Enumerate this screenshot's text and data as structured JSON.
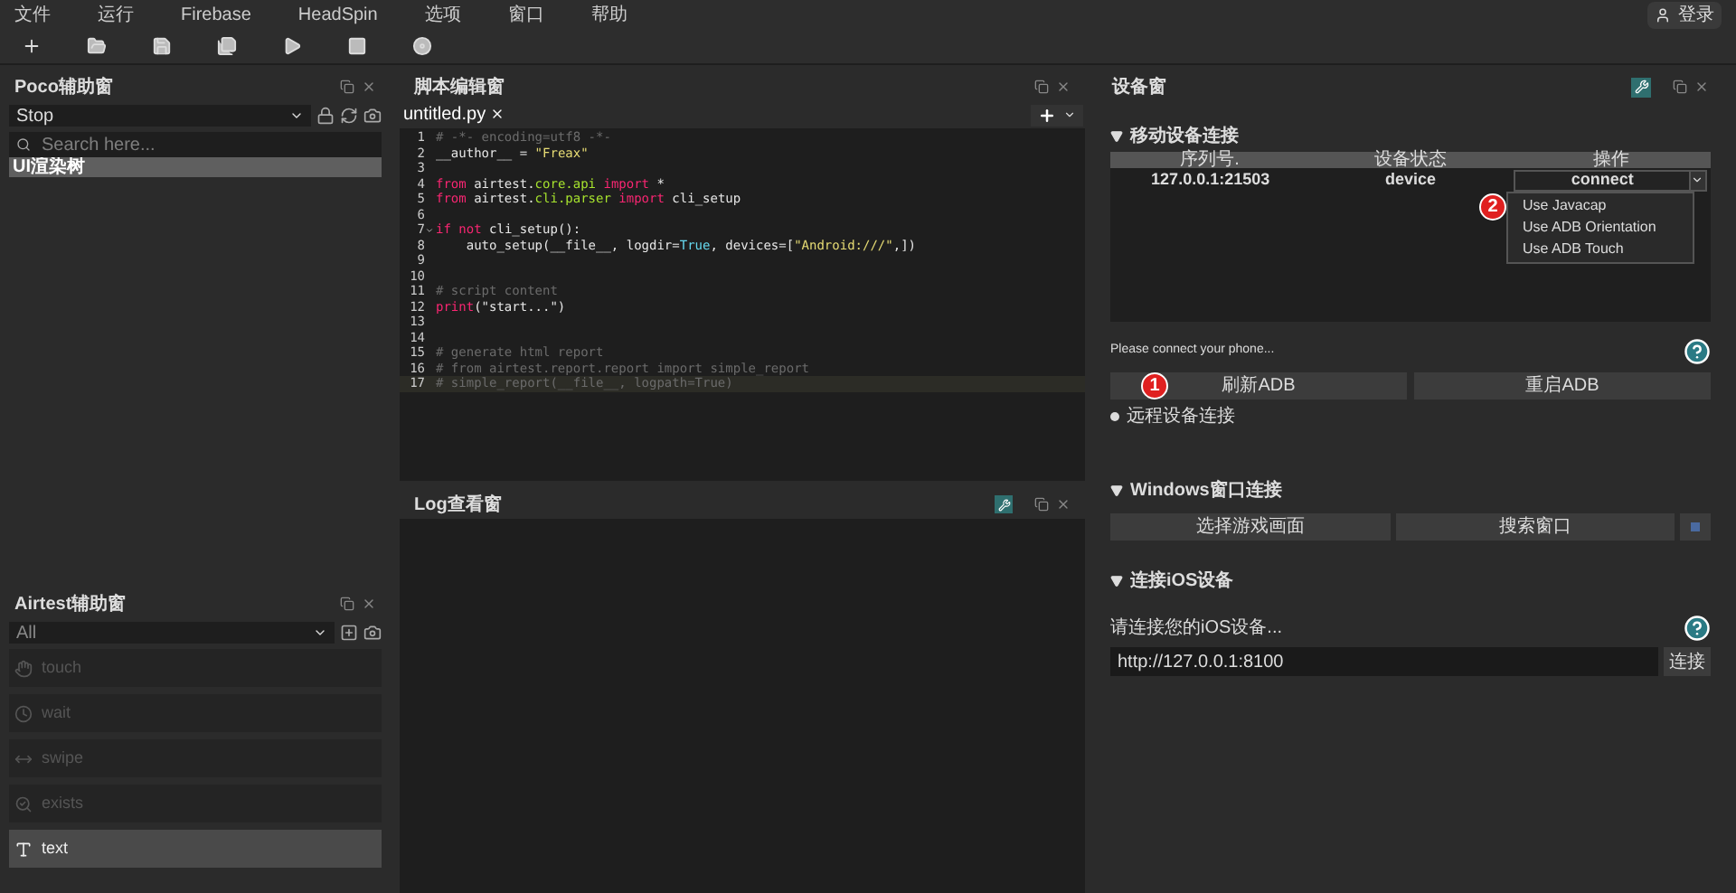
{
  "menu": [
    "文件",
    "运行",
    "Firebase",
    "HeadSpin",
    "选项",
    "窗口",
    "帮助"
  ],
  "user": "登录",
  "toolbar": [
    {
      "kind": "new"
    },
    {
      "kind": "open"
    },
    {
      "kind": "save"
    },
    {
      "kind": "saveas"
    },
    {
      "kind": "run"
    },
    {
      "kind": "stop"
    },
    {
      "kind": "record"
    }
  ],
  "poco": {
    "title": "Poco辅助窗",
    "mode": "Stop",
    "search": {
      "placeholder": "Search here..."
    },
    "tree": [
      {
        "label": "UI渲染树",
        "selected": true
      }
    ]
  },
  "airtest": {
    "title": "Airtest辅助窗",
    "filter": "All",
    "items": [
      {
        "label": "touch",
        "kind": "touch",
        "disabled": true
      },
      {
        "label": "wait",
        "kind": "wait",
        "disabled": true
      },
      {
        "label": "swipe",
        "kind": "swipe",
        "disabled": true
      },
      {
        "label": "exists",
        "kind": "exists",
        "disabled": true
      },
      {
        "label": "text",
        "kind": "text",
        "disabled": false
      }
    ]
  },
  "editor": {
    "title": "脚本编辑窗",
    "tabs": [
      {
        "label": "untitled.py",
        "selected": true
      }
    ],
    "lines": [
      {
        "n": "1",
        "fold": false,
        "current": false,
        "tokens": [
          {
            "kind": "comment",
            "text": "# -*- encoding=utf8 -*-"
          }
        ]
      },
      {
        "n": "2",
        "fold": false,
        "current": false,
        "tokens": [
          {
            "kind": "plain",
            "text": "__author__ = "
          },
          {
            "kind": "string",
            "text": "\"Freax\""
          }
        ]
      },
      {
        "n": "3",
        "fold": false,
        "current": false
      },
      {
        "n": "4",
        "fold": false,
        "current": false,
        "tokens": [
          {
            "kind": "keyword",
            "text": "from "
          },
          {
            "kind": "plain",
            "text": "airtest."
          },
          {
            "kind": "module",
            "text": "core.api"
          },
          {
            "kind": "keyword",
            "text": " import "
          },
          {
            "kind": "plain",
            "text": "*"
          }
        ]
      },
      {
        "n": "5",
        "fold": false,
        "current": false,
        "tokens": [
          {
            "kind": "keyword",
            "text": "from "
          },
          {
            "kind": "plain",
            "text": "airtest."
          },
          {
            "kind": "module",
            "text": "cli.parser"
          },
          {
            "kind": "keyword",
            "text": " import "
          },
          {
            "kind": "plain",
            "text": "cli_setup"
          }
        ]
      },
      {
        "n": "6",
        "fold": false,
        "current": false
      },
      {
        "n": "7",
        "fold": true,
        "current": false,
        "tokens": [
          {
            "kind": "keyword",
            "text": "if not "
          },
          {
            "kind": "plain",
            "text": "cli_setup():"
          }
        ]
      },
      {
        "n": "8",
        "fold": false,
        "current": false,
        "tokens": [
          {
            "kind": "plain",
            "text": "    auto_setup(__file__, logdir="
          },
          {
            "kind": "bool",
            "text": "True"
          },
          {
            "kind": "plain",
            "text": ", devices=["
          },
          {
            "kind": "string",
            "text": "\"Android:///\""
          },
          {
            "kind": "plain",
            "text": ",])"
          }
        ]
      },
      {
        "n": "9",
        "fold": false,
        "current": false
      },
      {
        "n": "10",
        "fold": false,
        "current": false
      },
      {
        "n": "11",
        "fold": false,
        "current": false,
        "tokens": [
          {
            "kind": "comment",
            "text": "# script content"
          }
        ]
      },
      {
        "n": "12",
        "fold": false,
        "current": false,
        "tokens": [
          {
            "kind": "keyword",
            "text": "print"
          },
          {
            "kind": "plain",
            "text": "(\"start...\")"
          }
        ]
      },
      {
        "n": "13",
        "fold": false,
        "current": false
      },
      {
        "n": "14",
        "fold": false,
        "current": false
      },
      {
        "n": "15",
        "fold": false,
        "current": false,
        "tokens": [
          {
            "kind": "comment",
            "text": "# generate html report"
          }
        ]
      },
      {
        "n": "16",
        "fold": false,
        "current": false,
        "tokens": [
          {
            "kind": "comment",
            "text": "# from airtest.report.report import simple_report"
          }
        ]
      },
      {
        "n": "17",
        "fold": false,
        "current": true,
        "tokens": [
          {
            "kind": "comment",
            "text": "# simple_report(__file__, logpath=True)"
          }
        ]
      }
    ]
  },
  "log": {
    "title": "Log查看窗"
  },
  "device": {
    "title": "设备窗",
    "android": {
      "title": "移动设备连接",
      "columns": [
        "序列号.",
        "设备状态",
        "操作"
      ],
      "rows": [
        {
          "serial": "127.0.0.1:21503",
          "status": "device",
          "action": "connect"
        }
      ],
      "menu": [
        "Use Javacap",
        "Use ADB Orientation",
        "Use ADB Touch"
      ],
      "hint": "Please connect your phone...",
      "buttons": [
        "刷新ADB",
        "重启ADB"
      ],
      "remote": "远程设备连接"
    },
    "windows": {
      "title": "Windows窗口连接",
      "buttons": [
        "选择游戏画面",
        "搜索窗口"
      ]
    },
    "ios": {
      "title": "连接iOS设备",
      "hint": "请连接您的iOS设备...",
      "url": "http://127.0.0.1:8100",
      "button": "连接"
    },
    "badges": [
      "1",
      "2"
    ]
  }
}
